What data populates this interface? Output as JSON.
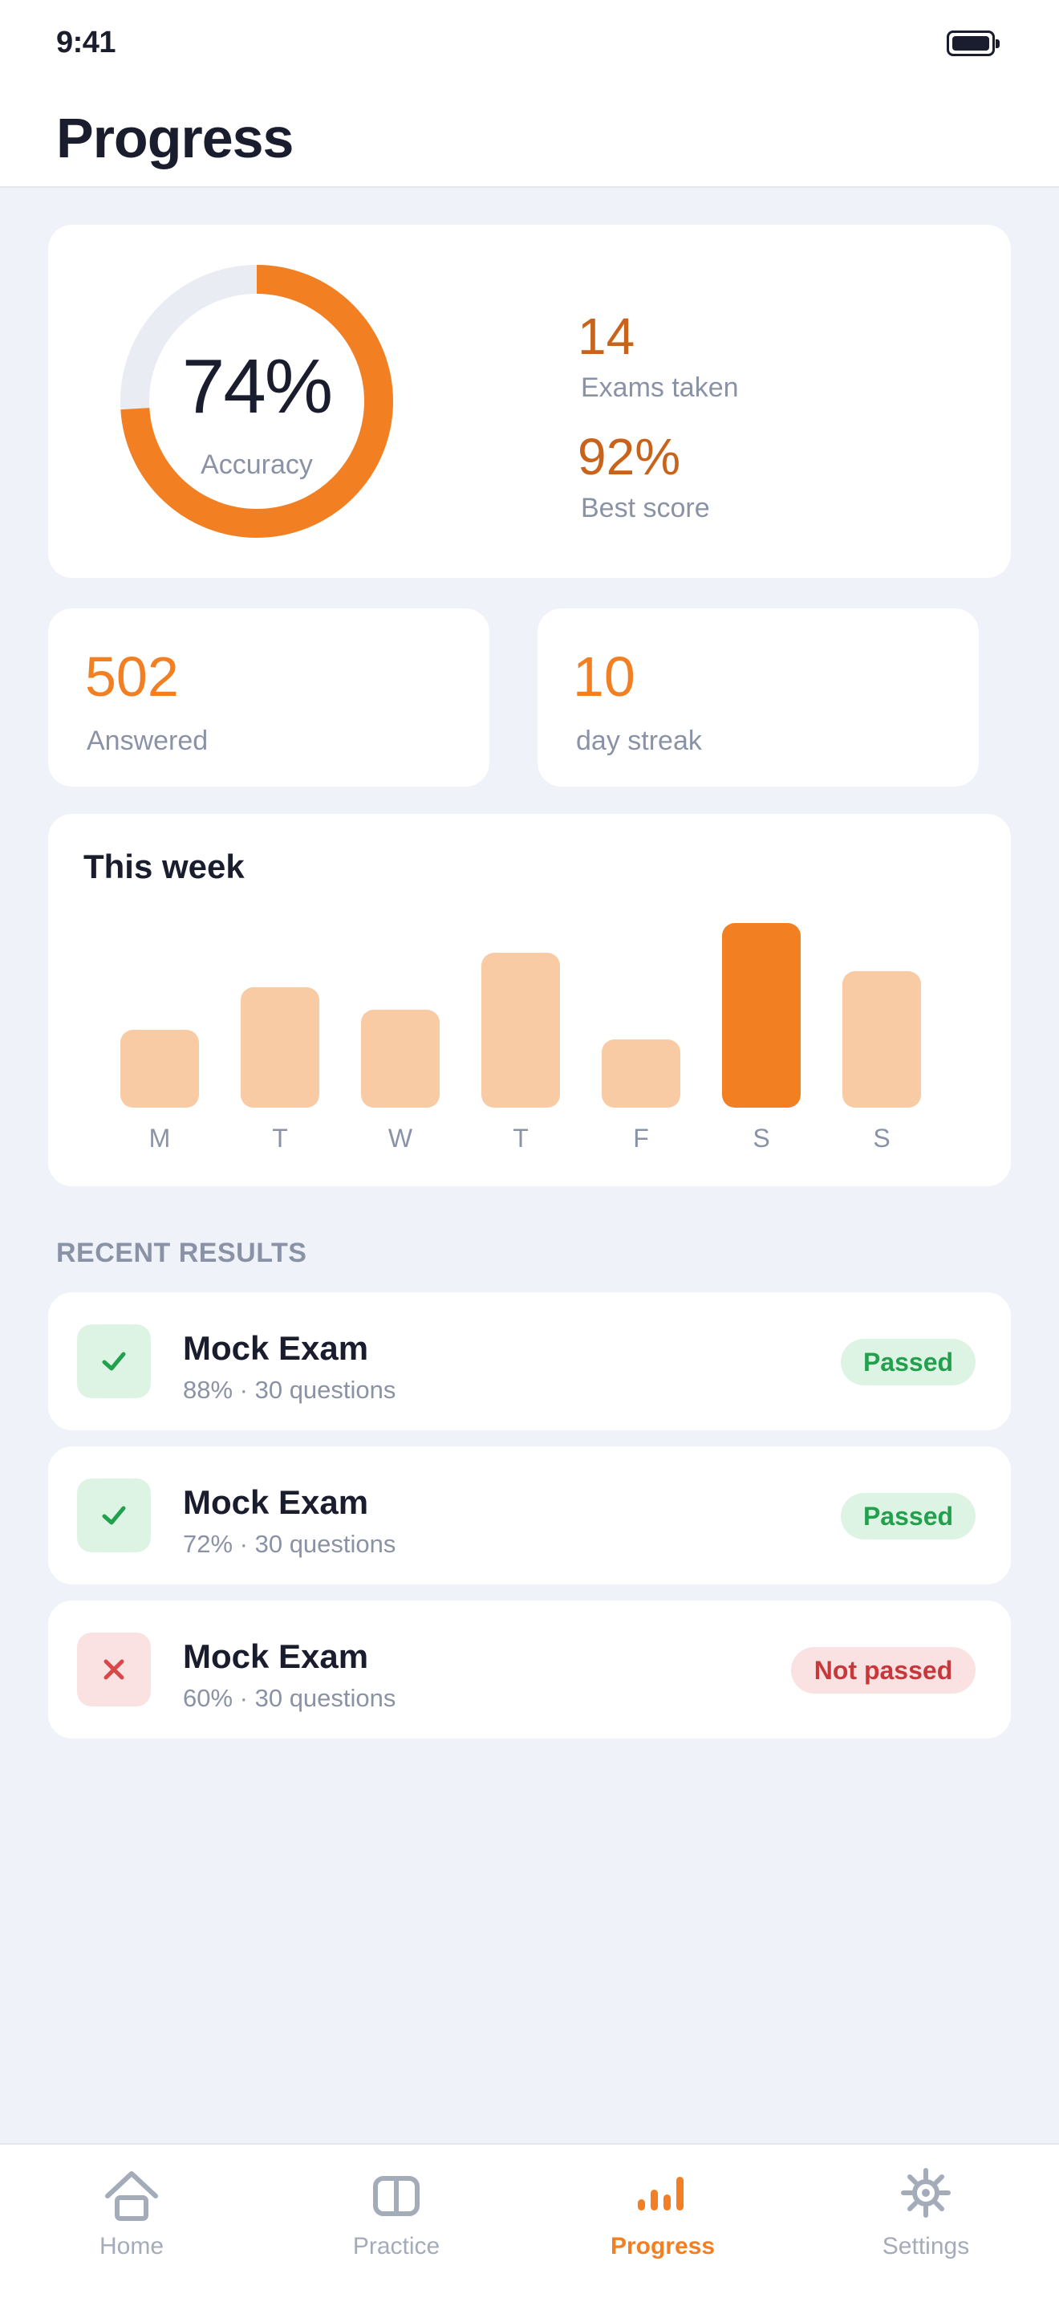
{
  "status_bar": {
    "time": "9:41"
  },
  "header": {
    "title": "Progress"
  },
  "summary": {
    "accuracy_value": "74%",
    "accuracy_label": "Accuracy",
    "accuracy_fraction": 0.74,
    "exams_taken_value": "14",
    "exams_taken_label": "Exams taken",
    "best_score_value": "92%",
    "best_score_label": "Best score"
  },
  "mini_stats": [
    {
      "value": "502",
      "label": "Answered"
    },
    {
      "value": "10",
      "label": "day streak"
    }
  ],
  "week": {
    "title": "This week",
    "chart_data": {
      "type": "bar",
      "categories": [
        "M",
        "T",
        "W",
        "T",
        "F",
        "S",
        "S"
      ],
      "values": [
        0.42,
        0.65,
        0.53,
        0.84,
        0.37,
        1.0,
        0.74
      ],
      "highlight_index": 5
    }
  },
  "recent": {
    "label": "RECENT RESULTS",
    "items": [
      {
        "title": "Mock Exam",
        "subtitle": "88% · 30 questions",
        "status": "Passed",
        "passed": true
      },
      {
        "title": "Mock Exam",
        "subtitle": "72% · 30 questions",
        "status": "Passed",
        "passed": true
      },
      {
        "title": "Mock Exam",
        "subtitle": "60% · 30 questions",
        "status": "Not passed",
        "passed": false
      }
    ]
  },
  "tabs": [
    {
      "label": "Home",
      "icon": "home-icon",
      "active": false
    },
    {
      "label": "Practice",
      "icon": "book-icon",
      "active": false
    },
    {
      "label": "Progress",
      "icon": "bar-chart-icon",
      "active": true
    },
    {
      "label": "Settings",
      "icon": "gear-icon",
      "active": false
    }
  ],
  "colors": {
    "accent": "#F28023",
    "accent_light": "#F9CBA4",
    "ring_track": "#E9ECF3",
    "pass": "#23A04E",
    "fail": "#C8383A",
    "inactive": "#A4ABB9"
  }
}
